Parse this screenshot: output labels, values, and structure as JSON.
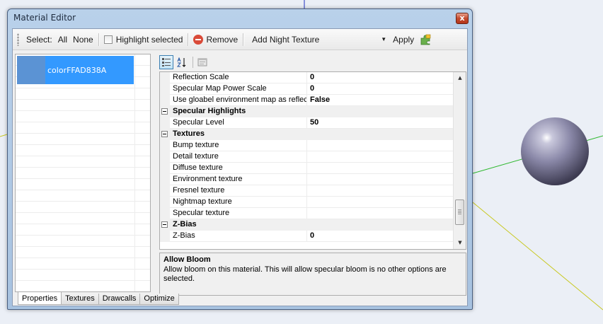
{
  "window": {
    "title": "Material Editor",
    "close": "x"
  },
  "toolbar": {
    "select_label": "Select:",
    "all_label": "All",
    "none_label": "None",
    "highlight_label": "Highlight selected",
    "remove_label": "Remove",
    "texture_dropdown_value": "Add Night Texture",
    "apply_label": "Apply"
  },
  "materials": [
    {
      "label": "colorFFAD838A",
      "selected": true
    }
  ],
  "property_grid": {
    "toolbar_icons": [
      "categorized-icon",
      "alphabetical-icon",
      "property-pages-icon"
    ],
    "rows": [
      {
        "type": "prop",
        "name": "Reflection Scale",
        "value": "0"
      },
      {
        "type": "prop",
        "name": "Specular Map Power Scale",
        "value": "0"
      },
      {
        "type": "prop",
        "name": "Use gloabel environment map as reflecti",
        "value": "False"
      },
      {
        "type": "category",
        "name": "Specular Highlights"
      },
      {
        "type": "prop",
        "name": "Specular Level",
        "value": "50"
      },
      {
        "type": "category",
        "name": "Textures"
      },
      {
        "type": "prop",
        "name": "Bump texture",
        "value": ""
      },
      {
        "type": "prop",
        "name": "Detail texture",
        "value": ""
      },
      {
        "type": "prop",
        "name": "Diffuse texture",
        "value": ""
      },
      {
        "type": "prop",
        "name": "Environment texture",
        "value": ""
      },
      {
        "type": "prop",
        "name": "Fresnel texture",
        "value": ""
      },
      {
        "type": "prop",
        "name": "Nightmap texture",
        "value": ""
      },
      {
        "type": "prop",
        "name": "Specular texture",
        "value": ""
      },
      {
        "type": "category",
        "name": "Z-Bias"
      },
      {
        "type": "prop",
        "name": "Z-Bias",
        "value": "0"
      }
    ]
  },
  "help": {
    "title": "Allow Bloom",
    "description": "Allow bloom on this material. This will allow specular bloom is no other options are selected."
  },
  "tabs": [
    {
      "label": "Properties",
      "active": true
    },
    {
      "label": "Textures",
      "active": false
    },
    {
      "label": "Drawcalls",
      "active": false
    },
    {
      "label": "Optimize",
      "active": false
    }
  ],
  "colors": {
    "selection": "#3399ff",
    "sphere": "#8a88a8",
    "window_frame": "#b9d1ea"
  }
}
